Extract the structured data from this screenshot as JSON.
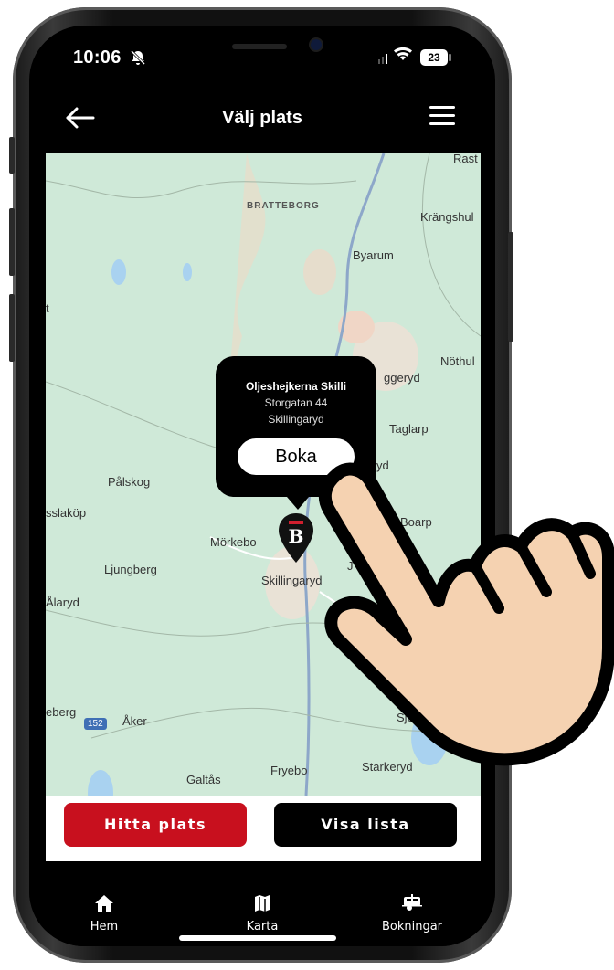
{
  "status_bar": {
    "time": "10:06",
    "battery": "23"
  },
  "header": {
    "title": "Välj plats"
  },
  "map": {
    "labels": {
      "bratteborg": "BRATTEBORG",
      "krangshult": "Krängshul",
      "byarum": "Byarum",
      "nothult": "Nöthul",
      "vaggeryd": "ggeryd",
      "taglarp": "Taglarp",
      "palskog": "Pålskog",
      "slakop": "sslaköp",
      "boarp": "Boarp",
      "morkebo": "Mörkebo",
      "ljungberg": "Ljungberg",
      "skillingaryd": "Skillingaryd",
      "alaryd": "Ålaryd",
      "eberg": "eberg",
      "aker": "Åker",
      "route": "152",
      "sjo": "Sjö",
      "galtas": "Galtås",
      "fryebo": "Fryebo",
      "starkeryd": "Starkeryd",
      "rast": "Rast",
      "t": "t",
      "yd": "yd",
      "j": "J"
    }
  },
  "popup": {
    "title": "Oljeshejkerna Skilli",
    "street": "Storgatan 44",
    "city": "Skillingaryd",
    "button": "Boka"
  },
  "marker": {
    "letter": "B"
  },
  "actions": {
    "find": "Hitta plats",
    "list": "Visa lista"
  },
  "tabs": [
    {
      "label": "Hem"
    },
    {
      "label": "Karta"
    },
    {
      "label": "Bokningar"
    }
  ]
}
